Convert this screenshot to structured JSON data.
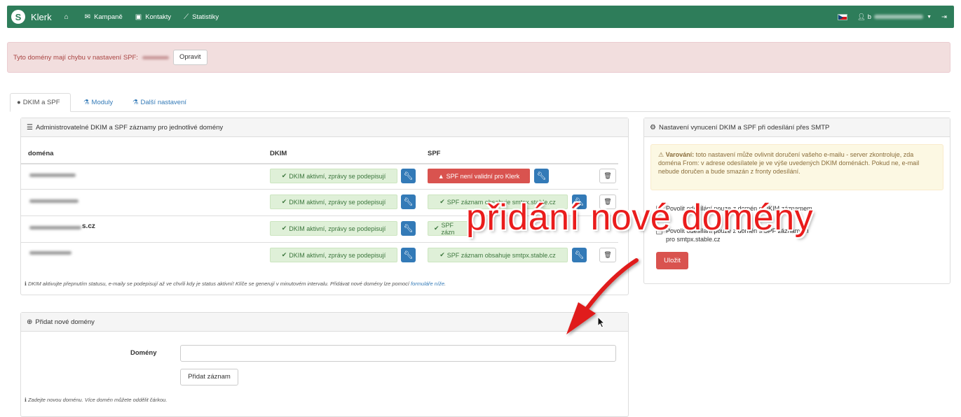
{
  "navbar": {
    "brand": "Klerk",
    "items": [
      {
        "label": "",
        "icon": "home-icon"
      },
      {
        "label": "Kampaně",
        "icon": "envelope-icon"
      },
      {
        "label": "Kontakty",
        "icon": "contact-book-icon"
      },
      {
        "label": "Statistiky",
        "icon": "chart-line-icon"
      }
    ],
    "user_prefix": "b"
  },
  "alert": {
    "text": "Tyto domény mají chybu v nastavení SPF:",
    "button": "Opravit"
  },
  "tabs": [
    {
      "label": "DKIM a SPF",
      "active": true
    },
    {
      "label": "Moduly",
      "active": false
    },
    {
      "label": "Další nastavení",
      "active": false
    }
  ],
  "records_panel": {
    "heading": "Administrovatelné DKIM a SPF záznamy pro jednotlivé domény",
    "columns": {
      "domain": "doména",
      "dkim": "DKIM",
      "spf": "SPF"
    },
    "rows": [
      {
        "domain": "",
        "dkim": "DKIM aktivní, zprávy se podepisují",
        "spf": "SPF není validní pro Klerk",
        "spf_status": "error"
      },
      {
        "domain": "",
        "dkim": "DKIM aktivní, zprávy se podepisují",
        "spf": "SPF záznam obsahuje smtpx.stable.cz",
        "spf_status": "ok"
      },
      {
        "domain": "s.cz",
        "dkim": "DKIM aktivní, zprávy se podepisují",
        "spf": "SPF zázn",
        "spf_status": "ok"
      },
      {
        "domain": "",
        "dkim": "DKIM aktivní, zprávy se podepisují",
        "spf": "SPF záznam obsahuje smtpx.stable.cz",
        "spf_status": "ok"
      }
    ],
    "note": "DKIM aktivujte přepnutím statusu, e-maily se podepisují až ve chvíli kdy je status aktivní! Klíče se generují v minutovém intervalu. Přidávat nové domény lze pomocí",
    "note_link": "formuláře níže",
    "note_end": "."
  },
  "add_panel": {
    "heading": "Přidat nové domény",
    "field_label": "Domény",
    "field_value": "",
    "button": "Přidat záznam",
    "note": "Zadejte novou doménu. Více domén můžete oddělit čárkou."
  },
  "smtp_panel": {
    "heading": "Nastavení vynucení DKIM a SPF při odesílání přes SMTP",
    "warning_strong": "Varování:",
    "warning_text": "toto nastavení může ovlivnit doručení vašeho e-mailu - server zkontroluje, zda doména From: v adrese odesílatele je ve výše uvedených DKIM doménách. Pokud ne, e-mail nebude doručen a bude smazán z fronty odesílání.",
    "option1": "Povolit odesílání pouze z domén s DKIM záznamem",
    "option2_line1": "Povolit odesílání pouze z domén s SPF záznamem",
    "option2_line2": "pro smtpx.stable.cz",
    "save": "Uložit"
  },
  "annotation": {
    "text": "přidání nové domény",
    "color": "#ea1c1c"
  },
  "colors": {
    "navbar": "#2e7d5a",
    "primary": "#337ab7",
    "danger": "#d9534f",
    "success_bg": "#dff0d8"
  }
}
